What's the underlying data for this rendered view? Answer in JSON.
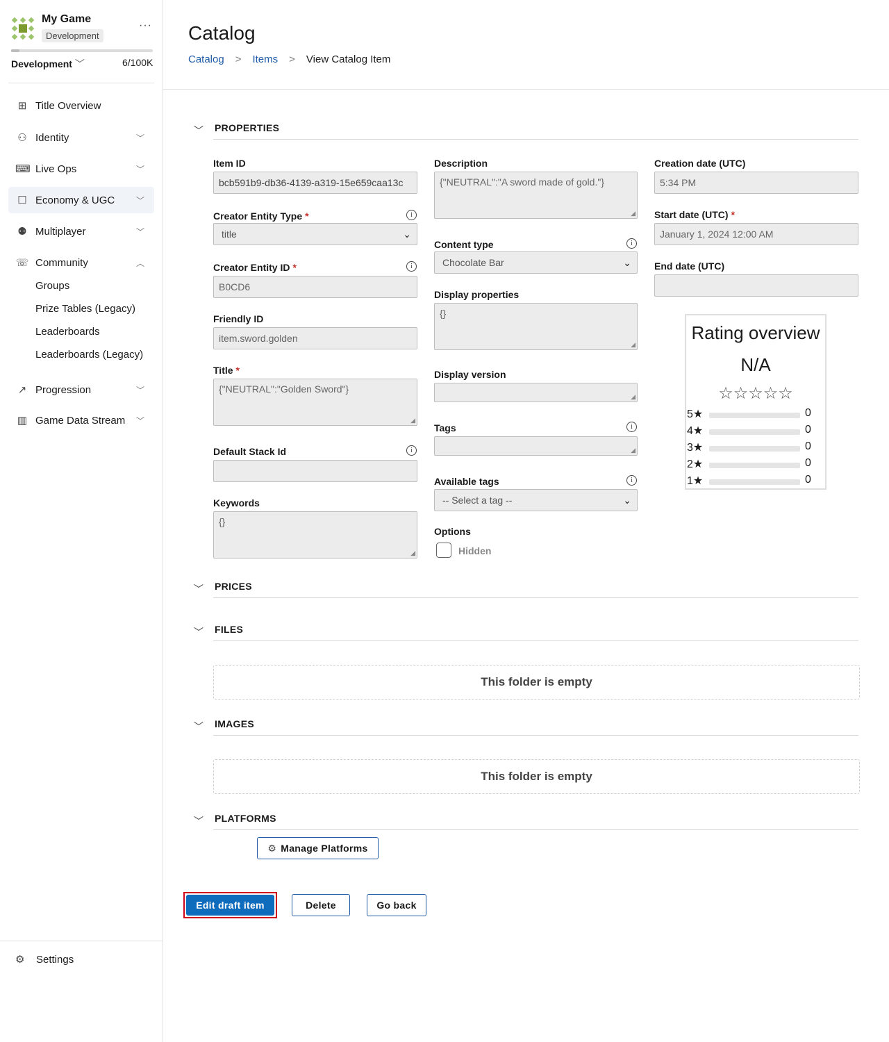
{
  "sidebar": {
    "game_name": "My Game",
    "env_badge": "Development",
    "more": "···",
    "usage_fraction": 0.06,
    "env_select": "Development",
    "usage": "6/100K",
    "items": [
      {
        "label": "Title Overview",
        "icon": "grid-icon"
      },
      {
        "label": "Identity",
        "icon": "identity-icon"
      },
      {
        "label": "Live Ops",
        "icon": "gamepad-icon"
      },
      {
        "label": "Economy & UGC",
        "icon": "bag-icon"
      },
      {
        "label": "Multiplayer",
        "icon": "people-icon"
      },
      {
        "label": "Community",
        "icon": "chat-icon"
      },
      {
        "label": "Progression",
        "icon": "trend-icon"
      },
      {
        "label": "Game Data Stream",
        "icon": "bar-chart-icon"
      }
    ],
    "community_sub": [
      "Groups",
      "Prize Tables (Legacy)",
      "Leaderboards",
      "Leaderboards (Legacy)"
    ],
    "settings": "Settings"
  },
  "header": {
    "title": "Catalog",
    "breadcrumbs": [
      "Catalog",
      "Items",
      "View Catalog Item"
    ]
  },
  "sections": {
    "properties": "PROPERTIES",
    "prices": "PRICES",
    "files": "FILES",
    "images": "IMAGES",
    "platforms": "PLATFORMS"
  },
  "fields": {
    "item_id": {
      "label": "Item ID",
      "value": "bcb591b9-db36-4139-a319-15e659caa13c"
    },
    "creator_entity_type": {
      "label": "Creator Entity Type",
      "value": "title"
    },
    "creator_entity_id": {
      "label": "Creator Entity ID",
      "value": "B0CD6"
    },
    "friendly_id": {
      "label": "Friendly ID",
      "value": "item.sword.golden"
    },
    "title": {
      "label": "Title",
      "value": "{\"NEUTRAL\":\"Golden Sword\"}"
    },
    "default_stack_id": {
      "label": "Default Stack Id",
      "value": ""
    },
    "keywords": {
      "label": "Keywords",
      "value": "{}"
    },
    "description": {
      "label": "Description",
      "value": "{\"NEUTRAL\":\"A sword made of gold.\"}"
    },
    "content_type": {
      "label": "Content type",
      "value": "Chocolate Bar"
    },
    "display_properties": {
      "label": "Display properties",
      "value": "{}"
    },
    "display_version": {
      "label": "Display version",
      "value": ""
    },
    "tags": {
      "label": "Tags",
      "value": ""
    },
    "available_tags": {
      "label": "Available tags",
      "value": "-- Select a tag --"
    },
    "options": {
      "label": "Options",
      "hidden_label": "Hidden"
    },
    "creation_date": {
      "label": "Creation date (UTC)",
      "value": "5:34 PM"
    },
    "start_date": {
      "label": "Start date (UTC)",
      "value": "January 1, 2024 12:00 AM"
    },
    "end_date": {
      "label": "End date (UTC)",
      "value": ""
    }
  },
  "rating": {
    "title": "Rating overview",
    "score": "N/A",
    "stars": "☆☆☆☆☆",
    "rows": [
      {
        "label": "5★",
        "count": "0"
      },
      {
        "label": "4★",
        "count": "0"
      },
      {
        "label": "3★",
        "count": "0"
      },
      {
        "label": "2★",
        "count": "0"
      },
      {
        "label": "1★",
        "count": "0"
      }
    ]
  },
  "files_empty": "This folder is empty",
  "images_empty": "This folder is empty",
  "manage_platforms": "Manage Platforms",
  "actions": {
    "edit": "Edit draft item",
    "delete": "Delete",
    "back": "Go back"
  },
  "colors": {
    "accent": "#0f6cbd",
    "link": "#1f5aa6",
    "required": "#c4312b",
    "focus": "#d0021b"
  }
}
